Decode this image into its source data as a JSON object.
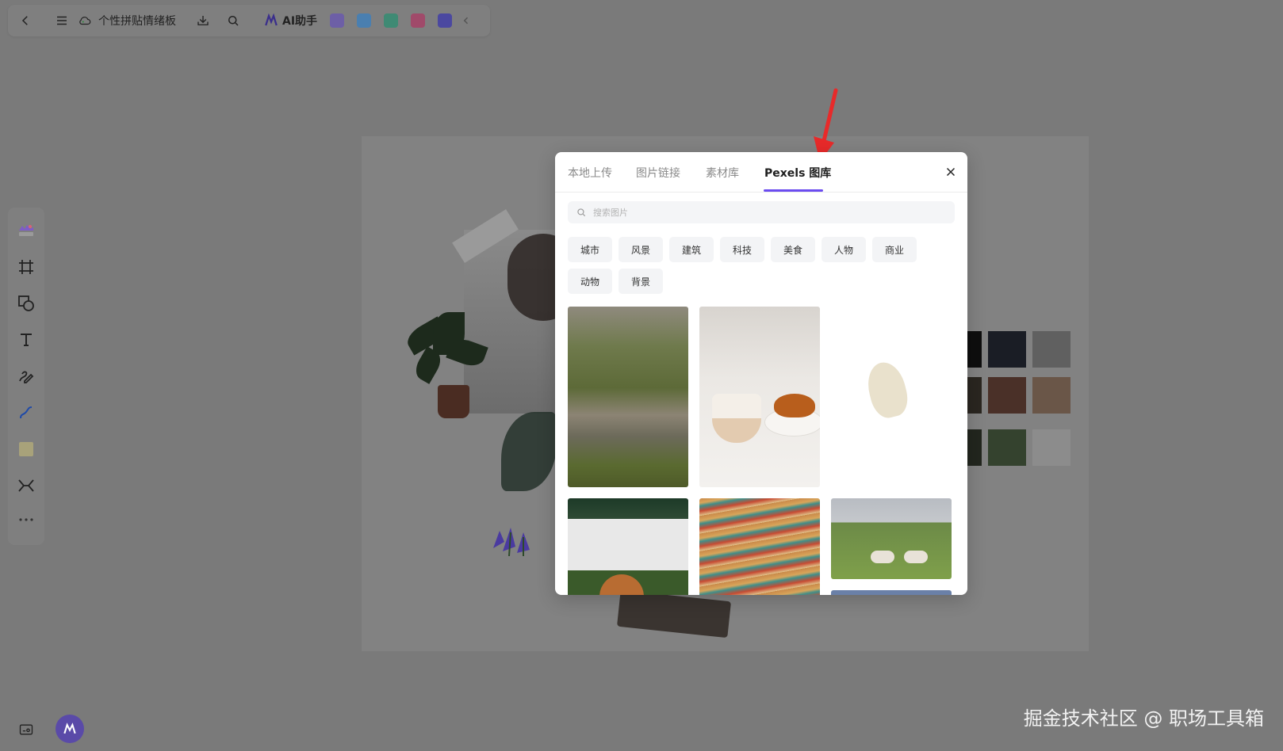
{
  "toolbar": {
    "doc_title": "个性拼贴情绪板",
    "ai_label": "AI助手",
    "icons": [
      "back-icon",
      "menu-icon",
      "cloud-saved-icon",
      "download-icon",
      "search-icon",
      "ai-assistant-icon",
      "plugin-icons",
      "collapse-icon"
    ]
  },
  "dialog": {
    "tabs": [
      {
        "label": "本地上传",
        "active": false
      },
      {
        "label": "图片链接",
        "active": false
      },
      {
        "label": "素材库",
        "active": false
      },
      {
        "label": "Pexels 图库",
        "active": true
      }
    ],
    "search_placeholder": "搜索图片",
    "categories": [
      "城市",
      "风景",
      "建筑",
      "科技",
      "美食",
      "人物",
      "商业",
      "动物",
      "背景"
    ],
    "accent": "#6b4cf0"
  },
  "watermark": "掘金技术社区 @ 职场工具箱"
}
